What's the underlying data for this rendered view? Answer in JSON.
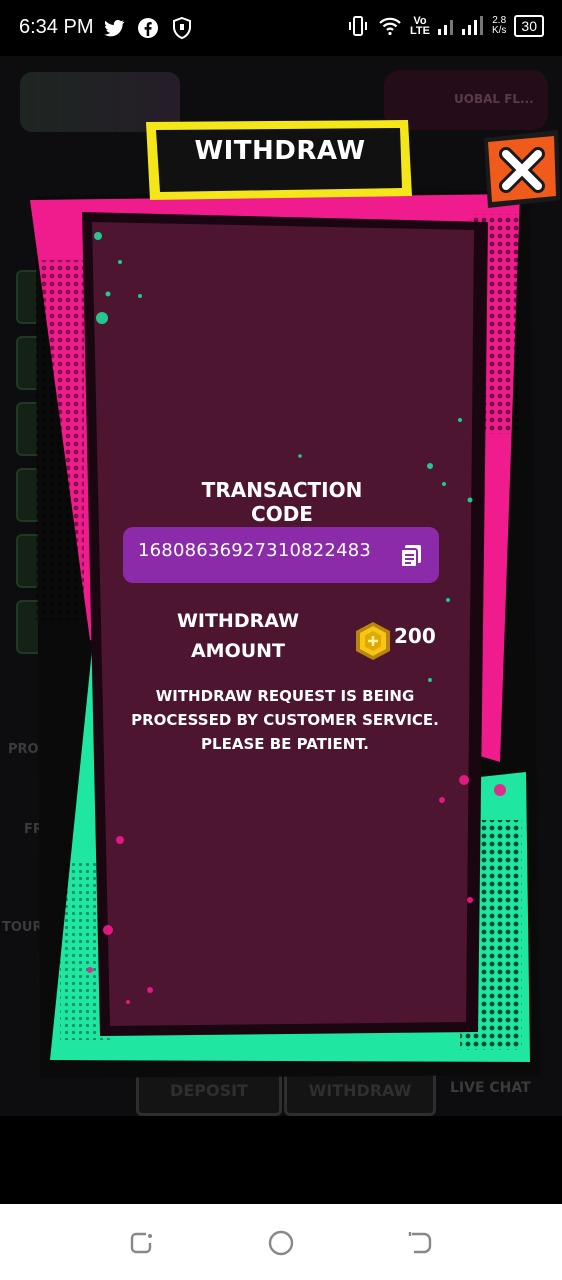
{
  "status_bar": {
    "time": "6:34 PM",
    "network_speed": "2.8",
    "network_speed_unit": "K/s",
    "lte_label_top": "Vo",
    "lte_label_bottom": "LTE",
    "battery": "30",
    "icons": [
      "twitter-icon",
      "facebook-icon",
      "shield-icon",
      "vibrate-icon",
      "wifi-icon",
      "signal-icon",
      "battery-icon"
    ]
  },
  "background": {
    "user_label": "UOBAL FL...",
    "side_labels": [
      "PROMO",
      "FRI",
      "TOUR"
    ],
    "bottom_buttons": [
      "DEPOSIT",
      "WITHDRAW"
    ],
    "live_chat": "LIVE CHAT"
  },
  "dialog": {
    "title": "WITHDRAW",
    "transaction_code_label": "TRANSACTION CODE",
    "transaction_code": "16808636927310822483",
    "withdraw_amount_label": "WITHDRAW AMOUNT",
    "amount": "200",
    "notice": "WITHDRAW REQUEST IS BEING PROCESSED BY CUSTOMER SERVICE. PLEASE BE PATIENT."
  },
  "colors": {
    "pink": "#f01b8c",
    "green": "#1fe6a0",
    "panel": "#4d1530",
    "code_box": "#8b2ba9",
    "banner_yellow": "#f5e61a",
    "close_orange": "#f05a1a"
  }
}
